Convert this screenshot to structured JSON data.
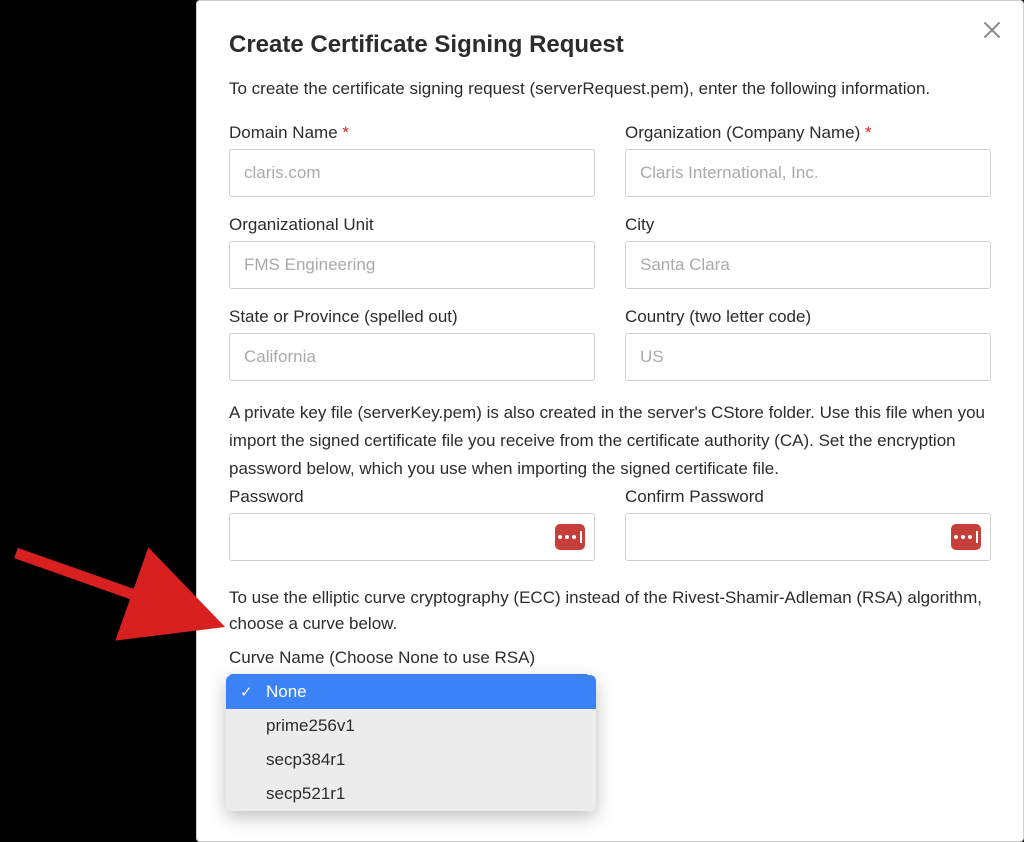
{
  "dialog": {
    "title": "Create Certificate Signing Request",
    "intro": "To create the certificate signing request (serverRequest.pem), enter the following information.",
    "fields": {
      "domain_label": "Domain Name ",
      "domain_placeholder": "claris.com",
      "org_label": "Organization (Company Name) ",
      "org_placeholder": "Claris International, Inc.",
      "ou_label": "Organizational Unit",
      "ou_placeholder": "FMS Engineering",
      "city_label": "City",
      "city_placeholder": "Santa Clara",
      "state_label": "State or Province (spelled out)",
      "state_placeholder": "California",
      "country_label": "Country (two letter code)",
      "country_placeholder": "US"
    },
    "required_mark": "*",
    "key_info": "A private key file (serverKey.pem) is also created in the server's CStore folder. Use this file when you import the signed certificate file you receive from the certificate authority (CA). Set the encryption password below, which you use when importing the signed certificate file.",
    "password_label": "Password",
    "confirm_password_label": "Confirm Password",
    "ecc_text": "To use the elliptic curve cryptography (ECC) instead of the Rivest-Shamir-Adleman (RSA) algorithm, choose a curve below.",
    "curve_label": "Curve Name (Choose None to use RSA)",
    "curve_options": {
      "o0": "None",
      "o1": "prime256v1",
      "o2": "secp384r1",
      "o3": "secp521r1"
    }
  }
}
